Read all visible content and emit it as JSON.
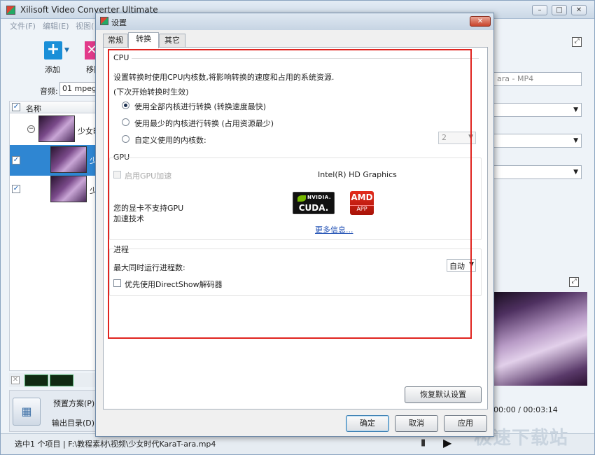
{
  "app": {
    "title": "Xilisoft Video Converter Ultimate",
    "window_buttons": [
      "–",
      "□",
      "✕"
    ],
    "menu": [
      "文件(F)",
      "编辑(E)",
      "视图("
    ],
    "toolbar": {
      "add_label": "添加",
      "remove_label": "移除"
    },
    "audio": {
      "label": "音频:",
      "value": "01 mpeg4"
    },
    "list": {
      "header": "名称",
      "items": [
        {
          "name": "少女时",
          "checked": false,
          "group": true
        },
        {
          "name": "少",
          "checked": true,
          "selected": true
        },
        {
          "name": "少",
          "checked": true,
          "selected": false
        }
      ]
    },
    "profile": {
      "preset_label": "预置方案(P):",
      "output_label": "输出目录(D):"
    },
    "status": {
      "text": "选中1 个项目 | F:\\教程素材\\视频\\少女时代KaraT-ara.mp4"
    },
    "right_panel": {
      "profile_field": "ara - MP4",
      "preview_time": "00:00 / 00:03:14"
    },
    "watermark": "极速下载站"
  },
  "dialog": {
    "title": "设置",
    "close_label": "✕",
    "tabs": [
      "常规",
      "转换",
      "其它"
    ],
    "active_tab": 1,
    "cpu": {
      "title": "CPU",
      "desc": "设置转换时使用CPU内核数,将影响转换的速度和占用的系统资源.",
      "note": "(下次开始转换时生效)",
      "options": [
        {
          "label": "使用全部内核进行转换 (转换速度最快)",
          "selected": true
        },
        {
          "label": "使用最少的内核进行转换 (占用资源最少)",
          "selected": false
        },
        {
          "label": "自定义使用的内核数:",
          "selected": false
        }
      ],
      "custom_cores": "2"
    },
    "gpu": {
      "title": "GPU",
      "enable_label": "启用GPU加速",
      "device": "Intel(R) HD Graphics",
      "unsupported_line1": "您的显卡不支持GPU",
      "unsupported_line2": "加速技术",
      "nvidia_top": "NVIDIA.",
      "nvidia_bottom": "CUDA.",
      "amd_top": "AMD",
      "amd_bottom": "APP",
      "more_info": "更多信息..."
    },
    "process": {
      "title": "进程",
      "max_label": "最大同时运行进程数:",
      "max_value": "自动",
      "directshow_label": "优先使用DirectShow解码器"
    },
    "buttons": {
      "restore": "恢复默认设置",
      "ok": "确定",
      "cancel": "取消",
      "apply": "应用"
    },
    "colors": {
      "highlight": "#e0241f",
      "link": "#1f4fb4"
    }
  }
}
